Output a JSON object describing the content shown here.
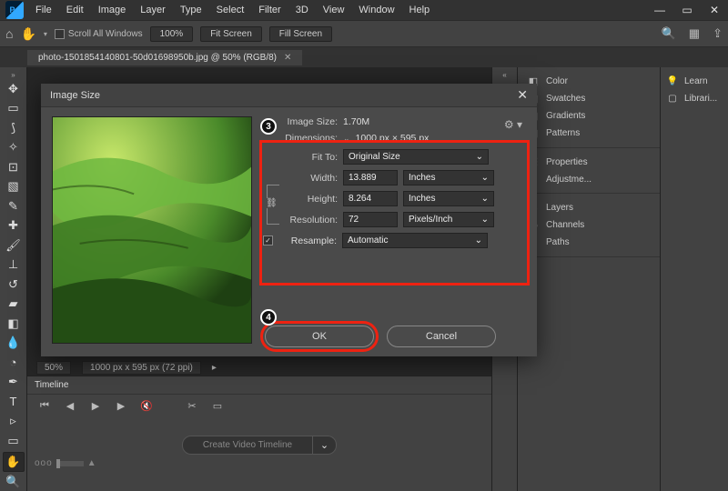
{
  "menu": [
    "File",
    "Edit",
    "Image",
    "Layer",
    "Type",
    "Select",
    "Filter",
    "3D",
    "View",
    "Window",
    "Help"
  ],
  "opt": {
    "scroll_all": "Scroll All Windows",
    "zoom": "100%",
    "fit": "Fit Screen",
    "fill": "Fill Screen"
  },
  "doc_tab": "photo-1501854140801-50d01698950b.jpg @ 50% (RGB/8)",
  "status": {
    "zoom": "50%",
    "info": "1000 px x 595 px (72 ppi)"
  },
  "timeline": {
    "title": "Timeline",
    "create": "Create Video Timeline"
  },
  "panels": {
    "g1": [
      [
        "◧",
        "Color"
      ],
      [
        "▦",
        "Swatches"
      ],
      [
        "▤",
        "Gradients"
      ],
      [
        "▥",
        "Patterns"
      ]
    ],
    "g2": [
      [
        "☰",
        "Properties"
      ],
      [
        "◐",
        "Adjustme..."
      ]
    ],
    "g3": [
      [
        "◈",
        "Layers"
      ],
      [
        "◉",
        "Channels"
      ],
      [
        "⌁",
        "Paths"
      ]
    ],
    "far": [
      [
        "💡",
        "Learn"
      ],
      [
        "▢",
        "Librari..."
      ]
    ]
  },
  "dialog": {
    "title": "Image Size",
    "size_lbl": "Image Size:",
    "size_val": "1.70M",
    "dim_lbl": "Dimensions:",
    "dim_val": "1000 px  ×  595 px",
    "fit_lbl": "Fit To:",
    "fit_val": "Original Size",
    "w_lbl": "Width:",
    "w_val": "13.889",
    "w_unit": "Inches",
    "h_lbl": "Height:",
    "h_val": "8.264",
    "h_unit": "Inches",
    "r_lbl": "Resolution:",
    "r_val": "72",
    "r_unit": "Pixels/Inch",
    "rs_lbl": "Resample:",
    "rs_val": "Automatic",
    "ok": "OK",
    "cancel": "Cancel"
  },
  "callouts": {
    "c3": "3",
    "c4": "4"
  }
}
